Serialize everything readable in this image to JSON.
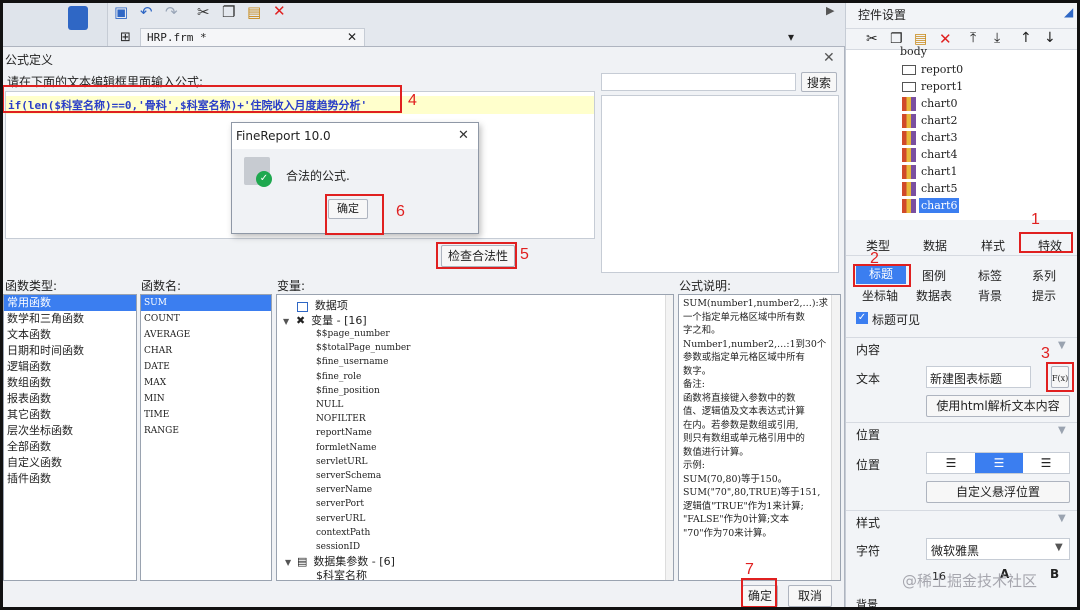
{
  "top_toolbar": {
    "tab_label": "HRP.frm *"
  },
  "right_panel": {
    "title": "控件设置",
    "tree_items": [
      {
        "label": "body",
        "type": "form"
      },
      {
        "label": "report0",
        "type": "report"
      },
      {
        "label": "report1",
        "type": "report"
      },
      {
        "label": "chart0",
        "type": "chart"
      },
      {
        "label": "chart2",
        "type": "chart"
      },
      {
        "label": "chart3",
        "type": "chart"
      },
      {
        "label": "chart4",
        "type": "chart"
      },
      {
        "label": "chart1",
        "type": "chart"
      },
      {
        "label": "chart5",
        "type": "chart"
      },
      {
        "label": "chart6",
        "type": "chart",
        "selected": true
      }
    ],
    "tabs": [
      "类型",
      "数据",
      "样式",
      "特效"
    ],
    "subtabs_row1": [
      "标题",
      "图例",
      "标签",
      "系列"
    ],
    "subtabs_row2": [
      "坐标轴",
      "数据表",
      "背景",
      "提示"
    ],
    "title_visible_label": "标题可见",
    "section_content": "内容",
    "text_label": "文本",
    "text_value": "新建图表标题",
    "fx_label": "F(x)",
    "html_parse_button": "使用html解析文本内容",
    "section_position": "位置",
    "position_label": "位置",
    "custom_float_button": "自定义悬浮位置",
    "section_style": "样式",
    "font_label": "字符",
    "font_value": "微软雅黑",
    "font_size": "16",
    "section_background": "背景",
    "watermark": "@稀土掘金技术社区"
  },
  "formula_dialog": {
    "title": "公式定义",
    "instruction": "请在下面的文本编辑框里面输入公式:",
    "formula": "if(len($科室名称)==0,'骨科',$科室名称)+'住院收入月度趋势分析'",
    "search_button": "搜索",
    "check_button": "检查合法性",
    "func_type_header": "函数类型:",
    "func_types": [
      "常用函数",
      "数学和三角函数",
      "文本函数",
      "日期和时间函数",
      "逻辑函数",
      "数组函数",
      "报表函数",
      "其它函数",
      "层次坐标函数",
      "全部函数",
      "自定义函数",
      "插件函数"
    ],
    "func_name_header": "函数名:",
    "func_names": [
      "SUM",
      "COUNT",
      "AVERAGE",
      "CHAR",
      "DATE",
      "MAX",
      "MIN",
      "TIME",
      "RANGE"
    ],
    "var_header": "变量:",
    "var_data_item": "数据项",
    "var_group": "变量 - [16]",
    "variables": [
      "$$page_number",
      "$$totalPage_number",
      "$fine_username",
      "$fine_role",
      "$fine_position",
      "NULL",
      "NOFILTER",
      "reportName",
      "formletName",
      "servletURL",
      "serverSchema",
      "serverName",
      "serverPort",
      "serverURL",
      "contextPath",
      "sessionID"
    ],
    "dataset_group": "数据集参数 - [6]",
    "dataset_param": "$科室名称",
    "desc_header": "公式说明:",
    "desc_lines": [
      "SUM(number1,number2,…):求",
      "一个指定单元格区域中所有数",
      "字之和。",
      "Number1,number2,…:1到30个",
      "参数或指定单元格区域中所有",
      "数字。",
      "备注:",
      "函数将直接键入参数中的数",
      "值、逻辑值及文本表达式计算",
      "在内。若参数是数组或引用,",
      "则只有数组或单元格引用中的",
      "数值进行计算。",
      "示例:",
      "SUM(70,80)等于150。",
      "SUM(\"70\",80,TRUE)等于151,",
      "逻辑值\"TRUE\"作为1来计算;",
      "\"FALSE\"作为0计算;文本",
      "\"70\"作为70来计算。"
    ],
    "ok_button": "确定",
    "cancel_button": "取消"
  },
  "popup": {
    "title": "FineReport 10.0",
    "message": "合法的公式.",
    "ok_button": "确定"
  },
  "annotations": [
    "1",
    "2",
    "3",
    "4",
    "5",
    "6",
    "7"
  ]
}
